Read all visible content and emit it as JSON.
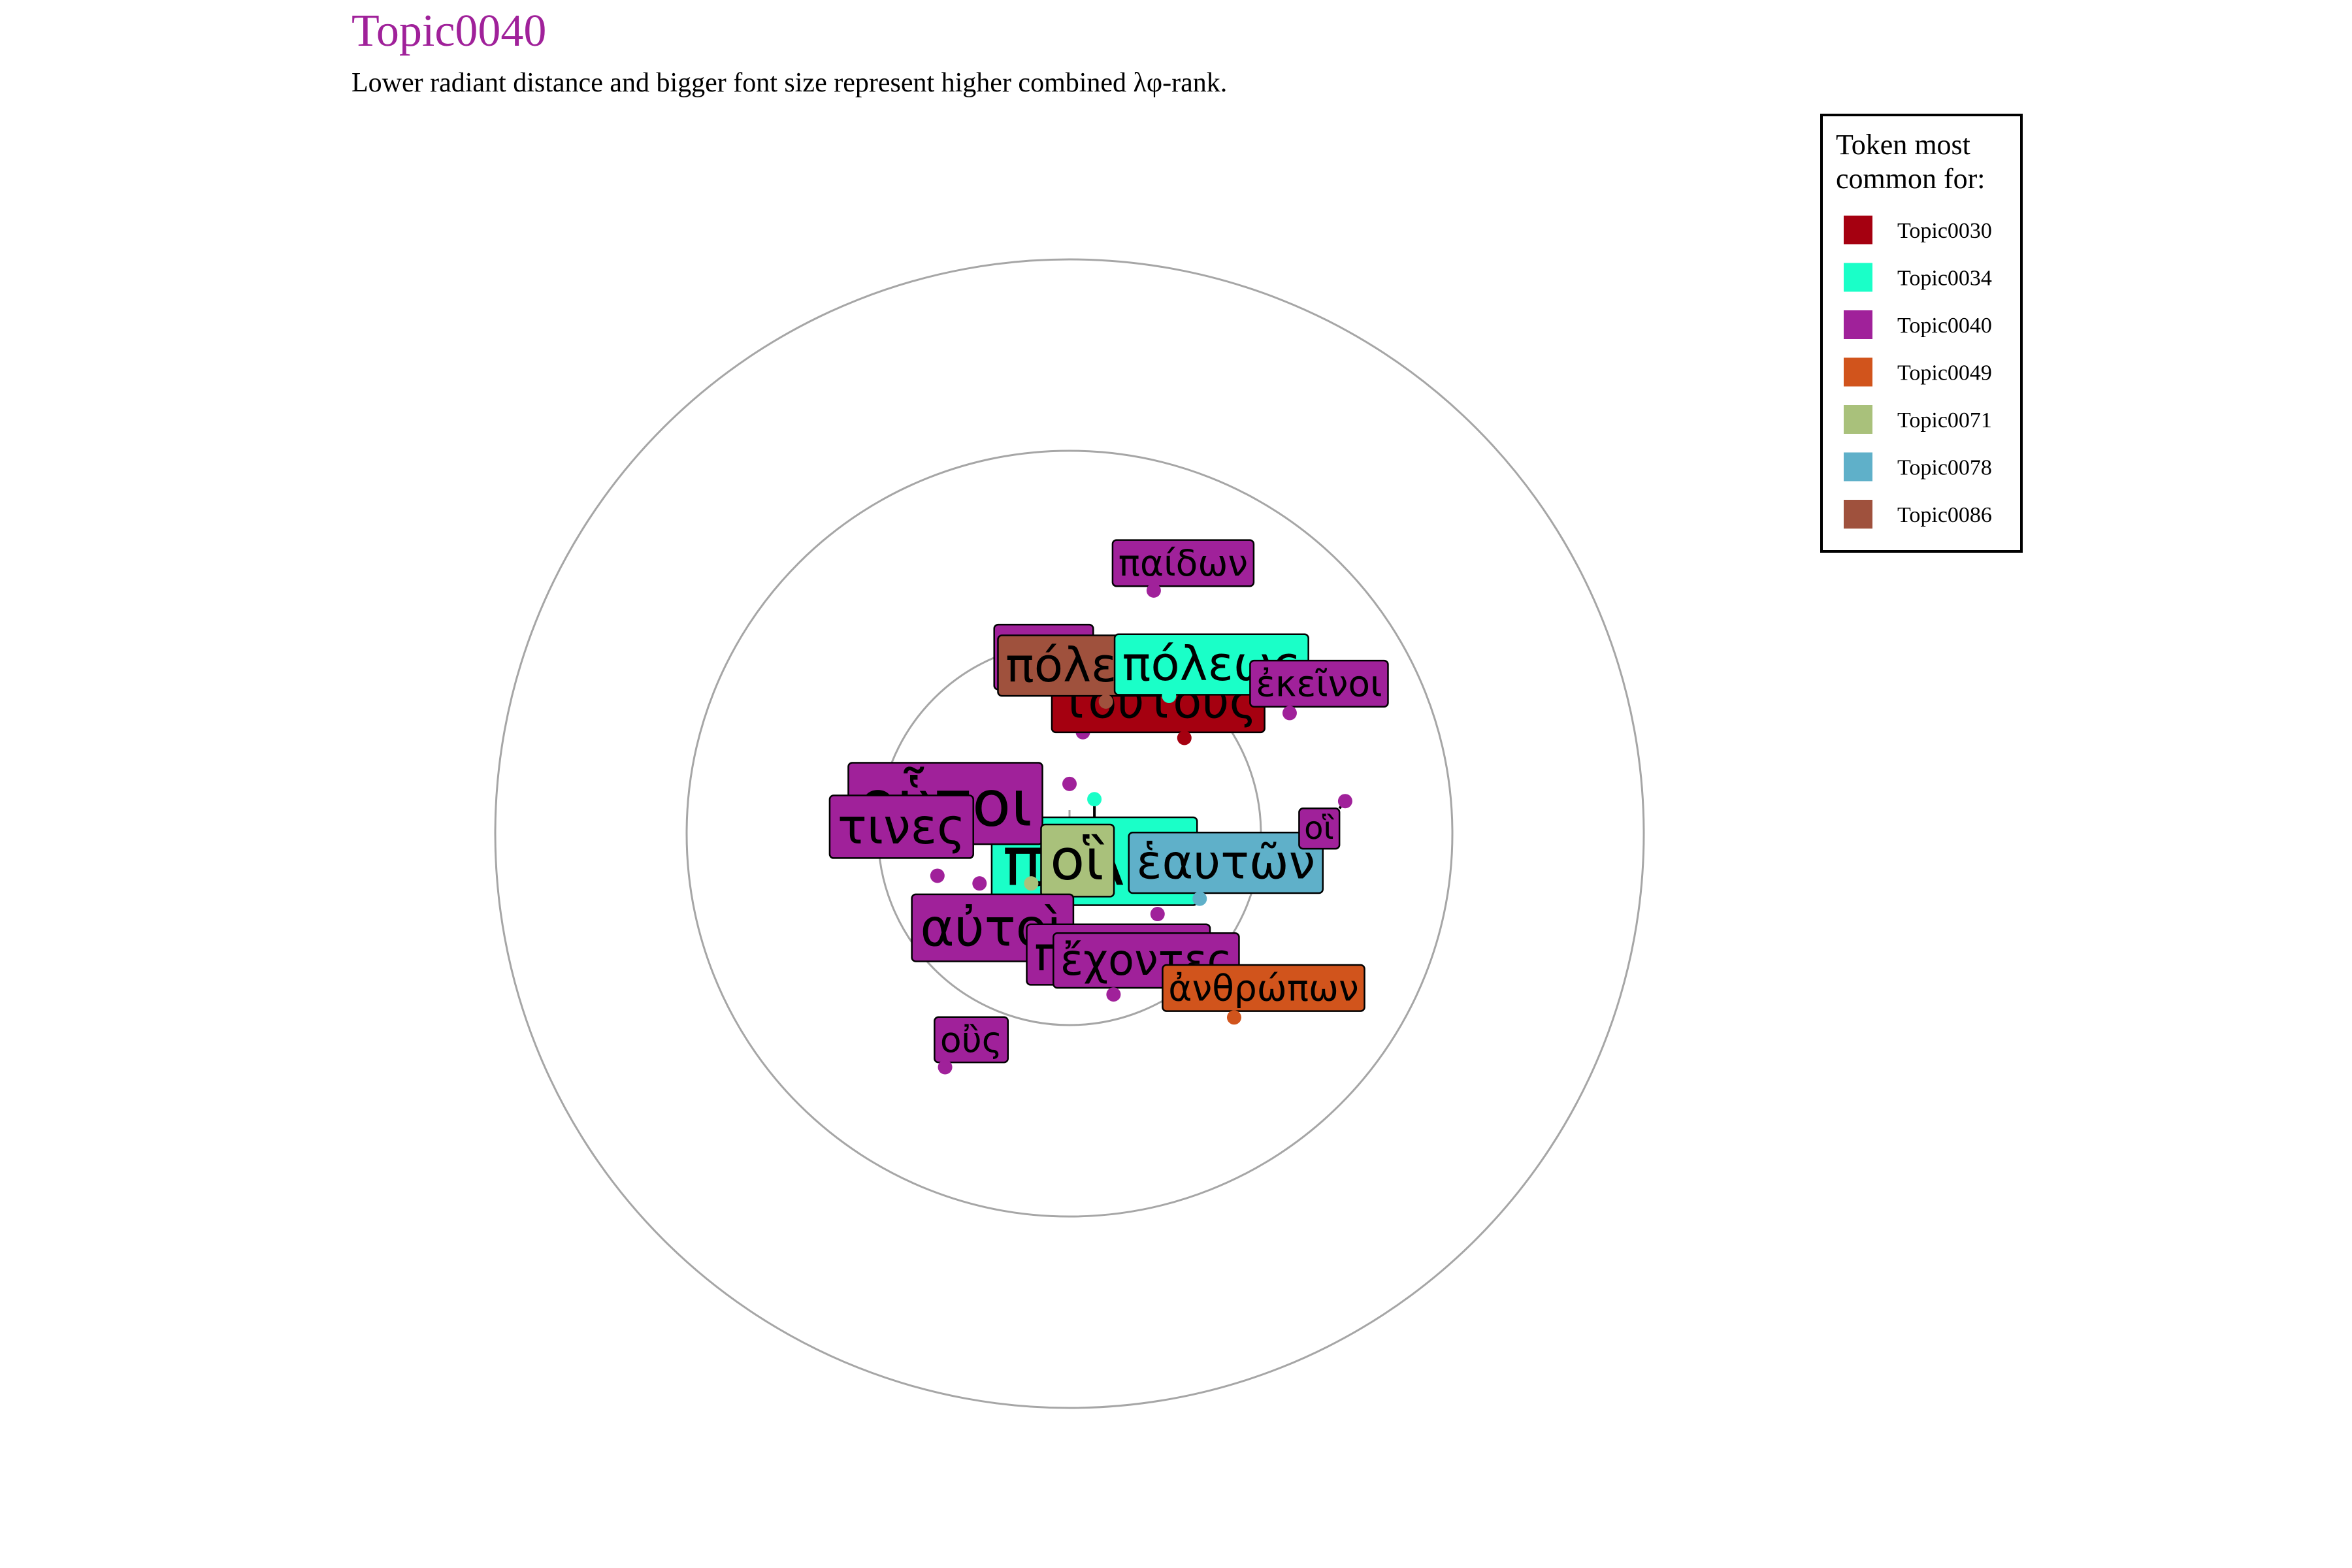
{
  "title": "Topic0040",
  "subtitle": "Lower radiant distance and bigger font size represent higher combined λφ-rank.",
  "colors": {
    "title": "#A0219A",
    "ring": "#A6A6A6"
  },
  "legend": {
    "title_line1": "Token most",
    "title_line2": "common for:",
    "placement": "top-right",
    "items": [
      {
        "name": "Topic0030",
        "color": "#A50010"
      },
      {
        "name": "Topic0034",
        "color": "#1AFFC8"
      },
      {
        "name": "Topic0040",
        "color": "#A0219A"
      },
      {
        "name": "Topic0049",
        "color": "#D1541C"
      },
      {
        "name": "Topic0071",
        "color": "#A9C17B"
      },
      {
        "name": "Topic0078",
        "color": "#5FB0C9"
      },
      {
        "name": "Topic0086",
        "color": "#9F513D"
      }
    ]
  },
  "chart_data": {
    "type": "scatter",
    "title": "Topic0040",
    "subtitle": "Lower radiant distance and bigger font size represent higher combined λφ-rank.",
    "coordinate_system": "polar",
    "radial_rings": 3,
    "legend_placement": "top-right",
    "tokens": [
      {
        "token": "πόλιν",
        "topic": "Topic0034",
        "x": 0.13,
        "y": 0.18,
        "size": 1.0
      },
      {
        "token": "οὗτοι",
        "topic": "Topic0040",
        "x": 0.0,
        "y": 0.26,
        "size": 0.9
      },
      {
        "token": "οἳ",
        "topic": "Topic0071",
        "x": -0.2,
        "y": -0.26,
        "size": 0.75
      },
      {
        "token": "got",
        "topic": "Topic0040",
        "x": 0.07,
        "y": 0.53,
        "size": 0.62
      },
      {
        "token": "αὐτοὶ",
        "topic": "Topic0040",
        "x": -0.47,
        "y": -0.26,
        "size": 0.65
      },
      {
        "token": "τινες",
        "topic": "Topic0040",
        "x": -0.69,
        "y": -0.22,
        "size": 0.58
      },
      {
        "token": "τούτους",
        "topic": "Topic0030",
        "x": 0.6,
        "y": 0.5,
        "size": 0.55
      },
      {
        "token": "πόλεις",
        "topic": "Topic0086",
        "x": 0.19,
        "y": 0.69,
        "size": 0.55
      },
      {
        "token": "πόλεως",
        "topic": "Topic0034",
        "x": 0.52,
        "y": 0.72,
        "size": 0.55
      },
      {
        "token": "ἑαυτῶν",
        "topic": "Topic0078",
        "x": 0.68,
        "y": -0.34,
        "size": 0.55
      },
      {
        "token": "πάντες",
        "topic": "Topic0040",
        "x": 0.46,
        "y": -0.42,
        "size": 0.55
      },
      {
        "token": "ἔχοντες",
        "topic": "Topic0040",
        "x": 0.23,
        "y": -0.84,
        "size": 0.45
      },
      {
        "token": "παίδων",
        "topic": "Topic0040",
        "x": 0.44,
        "y": 1.27,
        "size": 0.3
      },
      {
        "token": "ἐκεῖνοι",
        "topic": "Topic0040",
        "x": 1.15,
        "y": 0.63,
        "size": 0.3
      },
      {
        "token": "οἳ",
        "topic": "Topic0040",
        "x": 1.44,
        "y": 0.17,
        "size": 0.2
      },
      {
        "token": "ἀνθρώπων",
        "topic": "Topic0049",
        "x": 0.86,
        "y": -0.96,
        "size": 0.3
      },
      {
        "token": "οὒς",
        "topic": "Topic0040",
        "x": -0.65,
        "y": -1.22,
        "size": 0.28
      }
    ]
  }
}
